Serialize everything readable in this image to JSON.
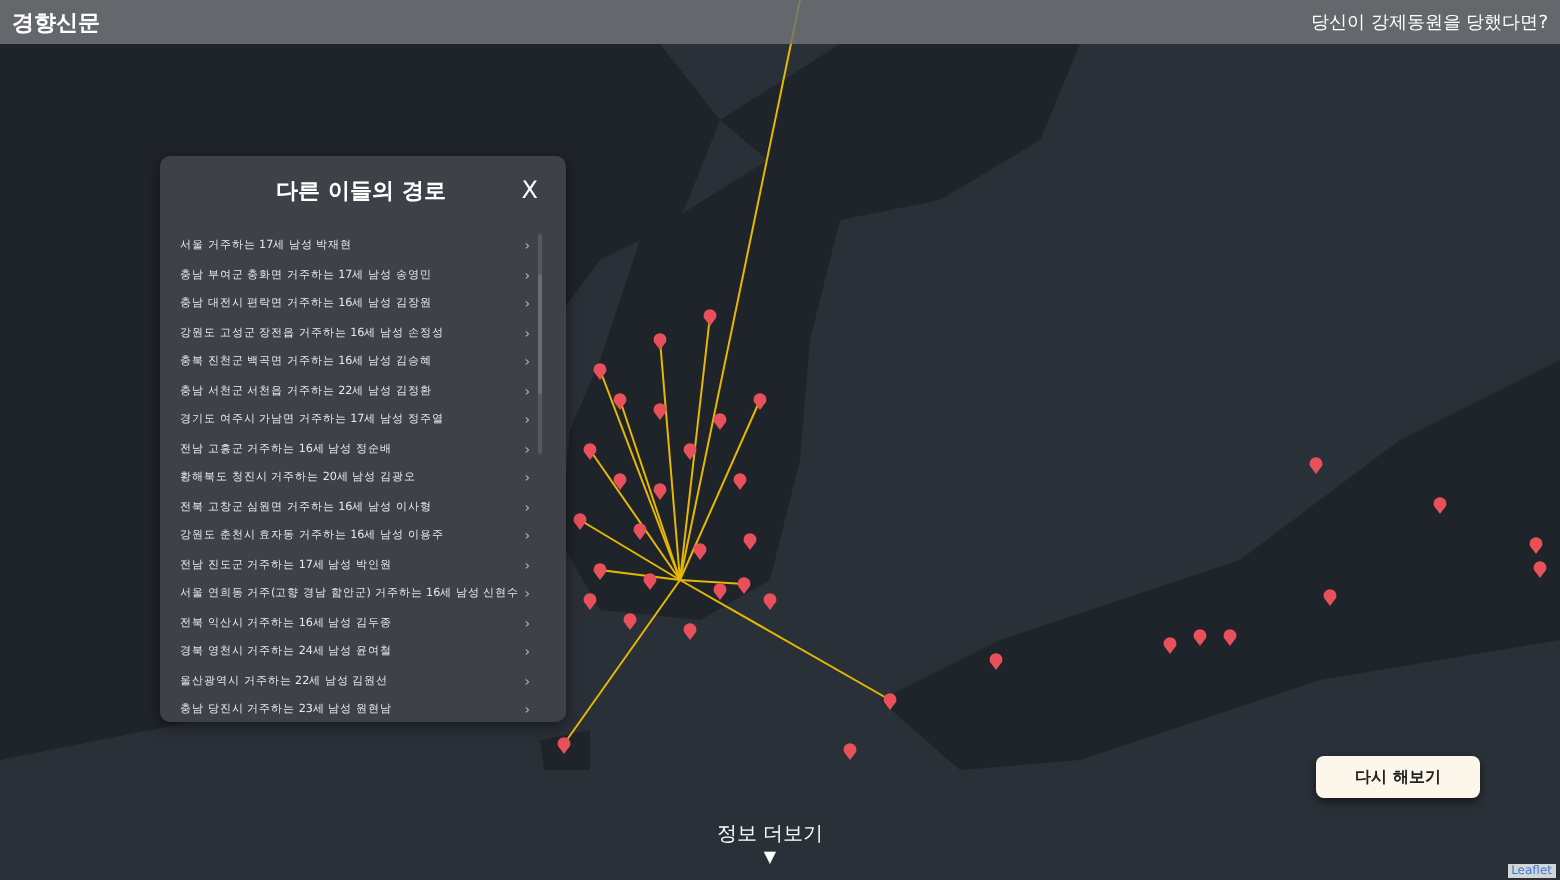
{
  "header": {
    "logo": "경향신문",
    "headline": "당신이 강제동원을 당했다면?"
  },
  "panel": {
    "title": "다른 이들의 경로",
    "close": "X",
    "items": [
      {
        "label": "서울 거주하는 17세 남성 박재현",
        "arrow": "›"
      },
      {
        "label": "충남 부여군 충화면 거주하는 17세 남성 송영민",
        "arrow": "›"
      },
      {
        "label": "충남 대전시 편락면 거주하는 16세 남성 김장원",
        "arrow": "›"
      },
      {
        "label": "강원도 고성군 장전읍 거주하는 16세 남성 손정성",
        "arrow": "›"
      },
      {
        "label": "충북 진천군 백곡면 거주하는 16세 남성 김승혜",
        "arrow": "›"
      },
      {
        "label": "충남 서천군 서천읍 거주하는 22세 남성 김정환",
        "arrow": "›"
      },
      {
        "label": "경기도 여주시 가남면 거주하는 17세 남성 정주열",
        "arrow": "›"
      },
      {
        "label": "전남 고흥군 거주하는 16세 남성 정순배",
        "arrow": "›"
      },
      {
        "label": "황해북도 청진시 거주하는 20세 남성 김광오",
        "arrow": "›"
      },
      {
        "label": "전북 고창군 심원면 거주하는 16세 남성 이사형",
        "arrow": "›"
      },
      {
        "label": "강원도 춘천시 효자동 거주하는 16세 남성 이용주",
        "arrow": "›"
      },
      {
        "label": "전남 진도군 거주하는 17세 남성 박인원",
        "arrow": "›"
      },
      {
        "label": "서울 연희동 거주(고향 경남 함안군) 거주하는 16세 남성 신현수",
        "arrow": "›"
      },
      {
        "label": "전북 익산시 거주하는 16세 남성 김두종",
        "arrow": "›"
      },
      {
        "label": "경북 영천시 거주하는 24세 남성 윤여철",
        "arrow": "›"
      },
      {
        "label": "울산광역시 거주하는 22세 남성 김원선",
        "arrow": "›"
      },
      {
        "label": "충남 당진시 거주하는 23세 남성 원현남",
        "arrow": "›"
      }
    ]
  },
  "retry_button": "다시 해보기",
  "more": {
    "label": "정보 더보기",
    "arrow": "▼"
  },
  "attribution": "Leaflet"
}
